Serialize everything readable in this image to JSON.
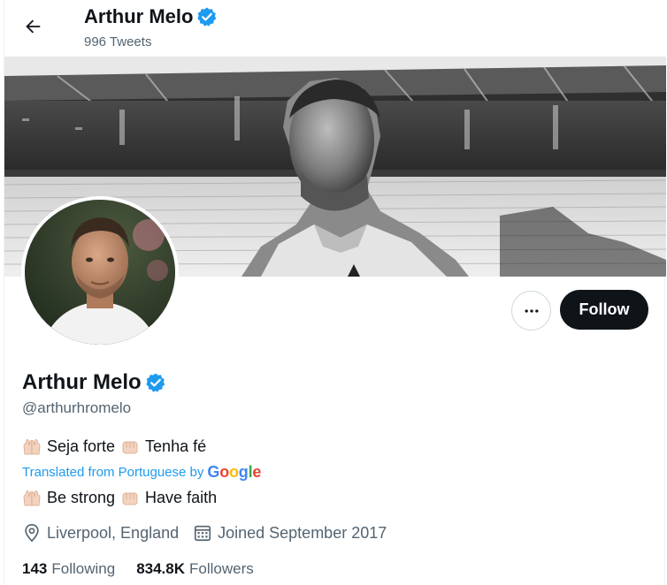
{
  "header": {
    "name": "Arthur Melo",
    "tweet_count": "996 Tweets"
  },
  "profile": {
    "name": "Arthur Melo",
    "handle": "@arthurhromelo",
    "bio": {
      "part1": "Seja forte",
      "part2": "Tenha fé"
    },
    "translated_label": "Translated from Portuguese by",
    "translated_brand": "Google",
    "bio_translated": {
      "part1": "Be strong",
      "part2": "Have faith"
    },
    "location": "Liverpool, England",
    "joined": "Joined September 2017",
    "following_count": "143",
    "following_label": "Following",
    "followers_count": "834.8K",
    "followers_label": "Followers"
  },
  "actions": {
    "follow_label": "Follow"
  },
  "icons": {
    "back": "arrow-left-icon",
    "verified": "verified-badge-icon",
    "more": "more-horizontal-icon",
    "location": "location-pin-icon",
    "calendar": "calendar-icon",
    "praying_hands": "raised-hands-emoji",
    "fist": "fist-emoji"
  },
  "colors": {
    "accent": "#1d9bf0",
    "verified": "#1d9bf0",
    "text_primary": "#0f1419",
    "text_secondary": "#536471",
    "follow_bg": "#0f1419"
  }
}
